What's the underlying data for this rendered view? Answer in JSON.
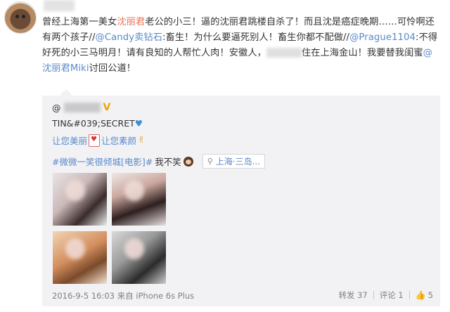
{
  "post": {
    "seg1": "曾经上海第一美女",
    "link1": "沈丽君",
    "seg2": "老公的小三！逼的沈丽君跳楼自杀了！而且沈是癌症晚期……可怜啊还有两个孩子//",
    "mention1": "@Candy卖钻石",
    "seg3": ":畜生！为什么要逼死别人！畜生你都不配做//",
    "mention2": "@Prague1104",
    "seg4": ":不得好死的小三马明月！请有良知的人帮忙人肉！安徽人，",
    "seg5": "住在上海金山！我要替我闺蜜",
    "mention3": "@沈丽君Miki",
    "seg6": "讨回公道！"
  },
  "repost": {
    "user_prefix": "@",
    "line1_text": "TIN&#039;SECRET",
    "line1_icon": "blue-heart",
    "line2_a": "让您美丽",
    "line2_b": "让您素颜",
    "topic": "#微微一笑很倾城[电影]#",
    "line3_text": "我不笑",
    "location": "上海·三岛...",
    "footer": "2016-9-5 16:03 来自 iPhone 6s Plus",
    "actions": {
      "forward": "转发 37",
      "comment": "评论 1",
      "like": "5"
    }
  },
  "colors": {
    "link_orange": "#eb7350",
    "mention_blue": "#5a89c8",
    "repost_bg": "#f2f2f5"
  }
}
